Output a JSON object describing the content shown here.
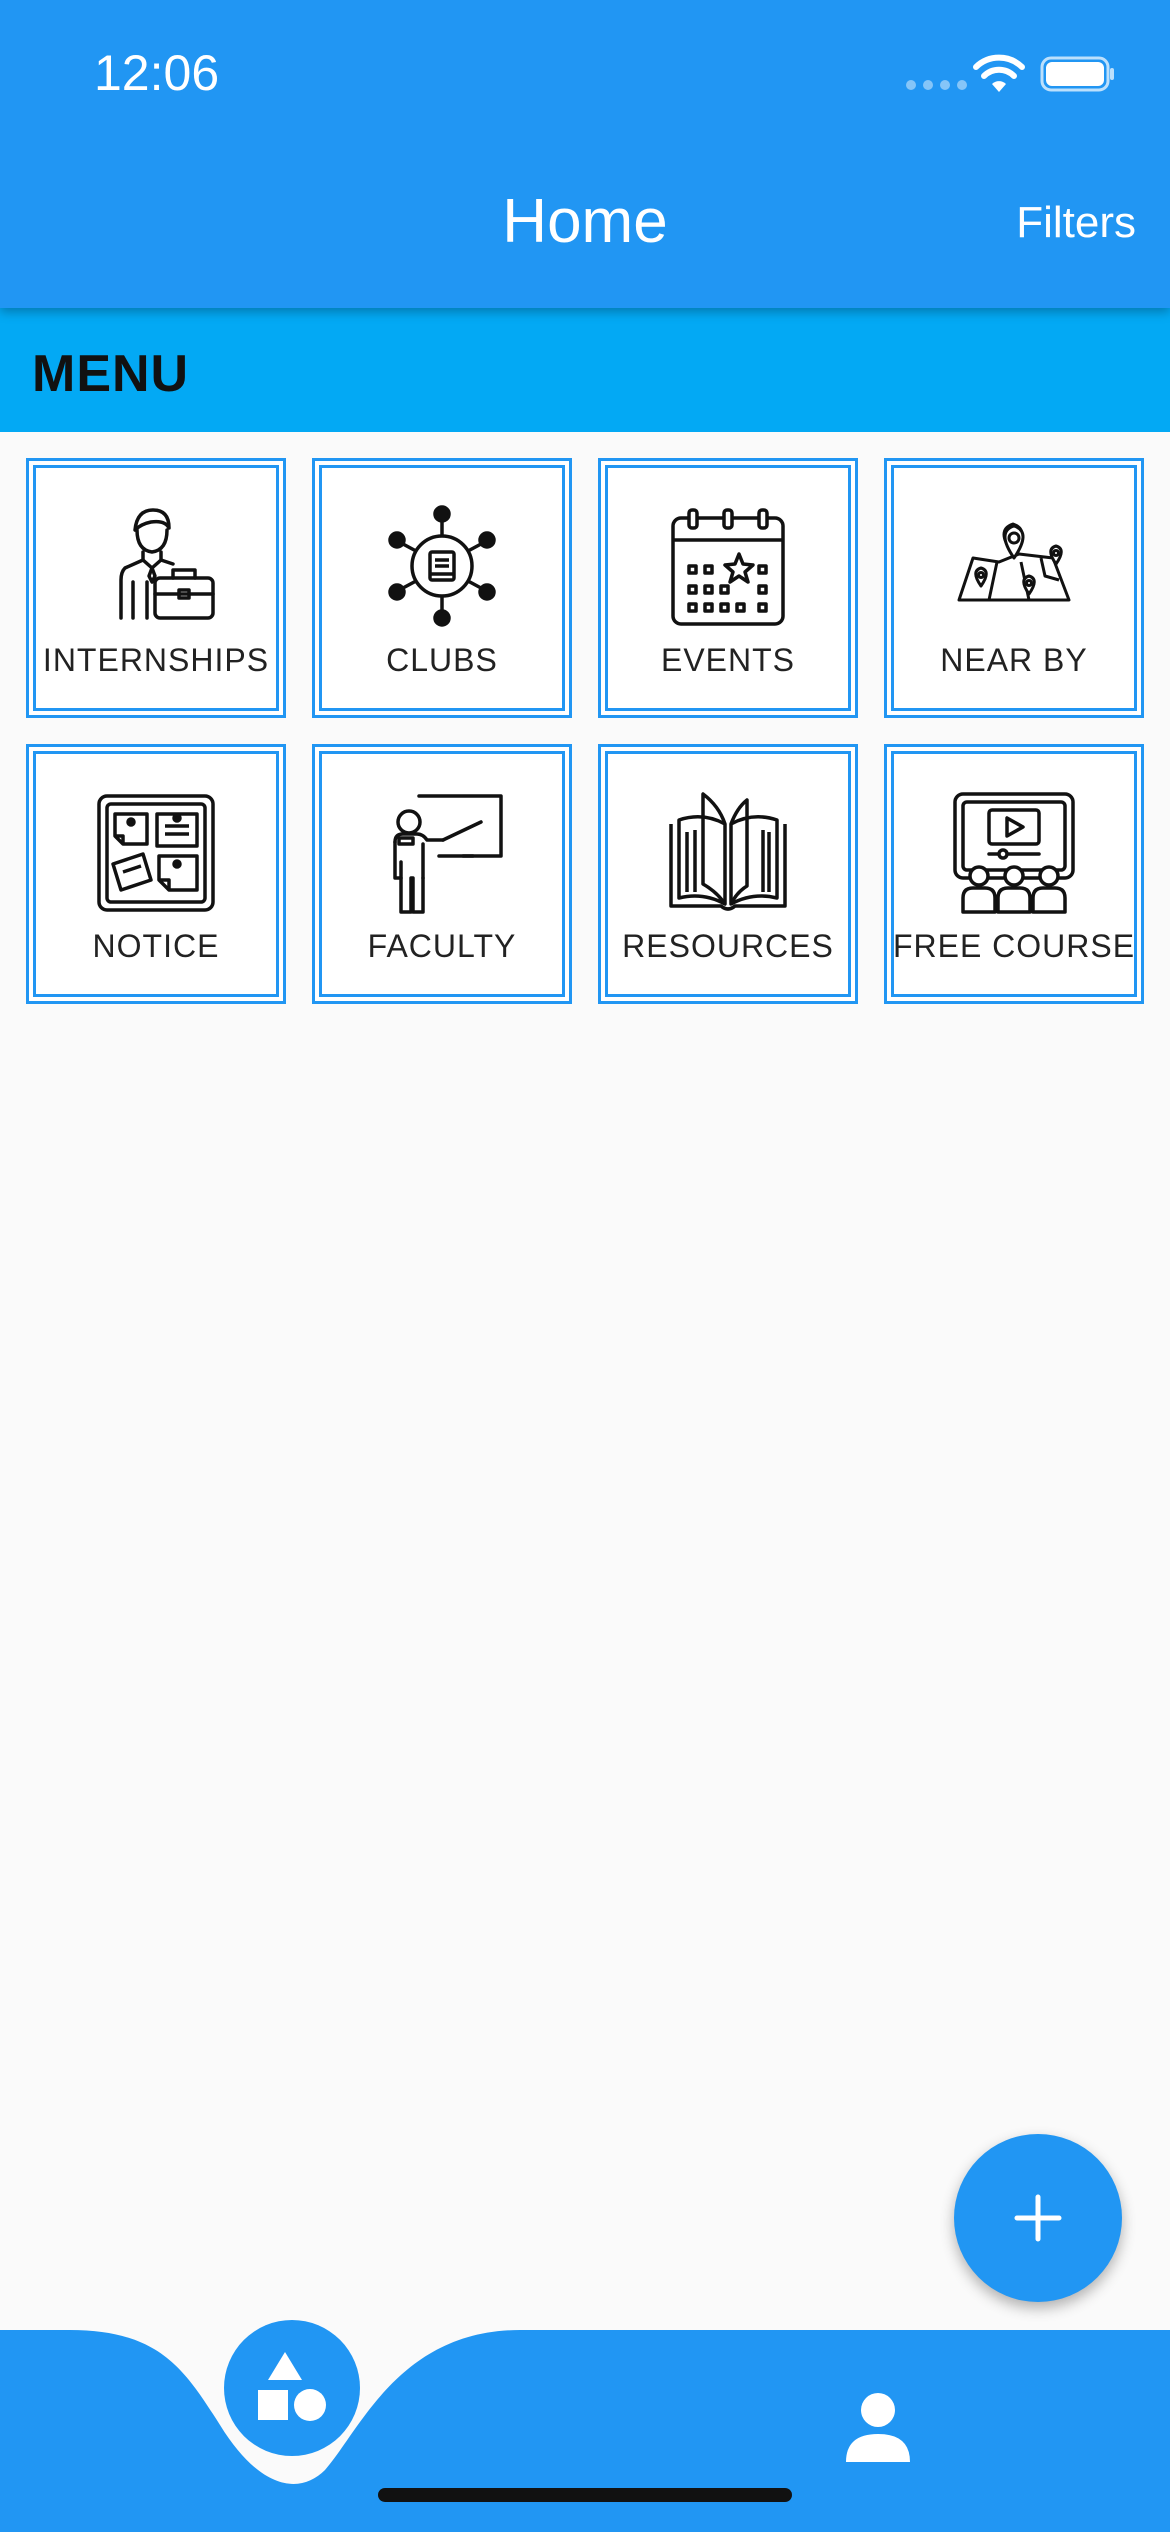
{
  "status_bar": {
    "time": "12:06"
  },
  "app_bar": {
    "title": "Home",
    "filters_label": "Filters"
  },
  "menu": {
    "header": "MENU",
    "items": [
      {
        "label": "INTERNSHIPS",
        "icon": "internship-icon"
      },
      {
        "label": "CLUBS",
        "icon": "clubs-icon"
      },
      {
        "label": "EVENTS",
        "icon": "events-calendar-icon"
      },
      {
        "label": "NEAR BY",
        "icon": "map-pins-icon"
      },
      {
        "label": "NOTICE",
        "icon": "notice-board-icon"
      },
      {
        "label": "FACULTY",
        "icon": "teacher-board-icon"
      },
      {
        "label": "RESOURCES",
        "icon": "open-book-icon"
      },
      {
        "label": "FREE COURSE",
        "icon": "video-course-icon"
      }
    ]
  },
  "fab": {
    "icon": "plus-icon"
  },
  "bottom_nav": {
    "items": [
      {
        "icon": "shapes-icon"
      },
      {
        "icon": "person-icon"
      }
    ]
  },
  "colors": {
    "primary": "#2196f3",
    "menu_header": "#03a9f4",
    "background": "#fafafa"
  }
}
